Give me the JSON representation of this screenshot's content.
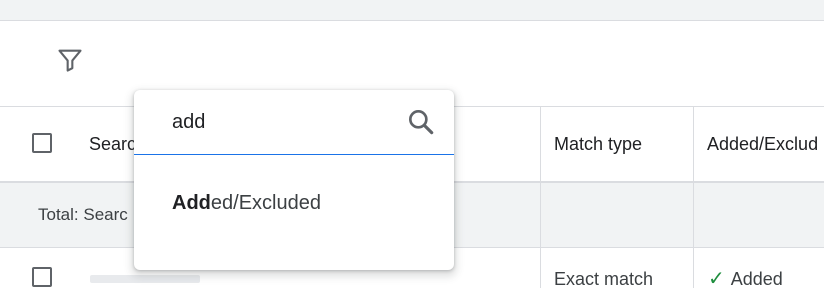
{
  "filter": {
    "icon": "filter-icon"
  },
  "table": {
    "headers": {
      "search": "Searc",
      "match_type": "Match type",
      "added_excluded": "Added/Exclud"
    },
    "total_row": {
      "label": "Total: Searc"
    },
    "rows": [
      {
        "match_type": "Exact match",
        "added_excluded": "Added",
        "status_icon": "check-icon",
        "status_color": "#1e8e3e"
      }
    ]
  },
  "dropdown": {
    "search_value": "add",
    "search_icon": "search-icon",
    "accent_color": "#1a73e8",
    "option": {
      "match": "Add",
      "rest": "ed/Excluded"
    }
  }
}
